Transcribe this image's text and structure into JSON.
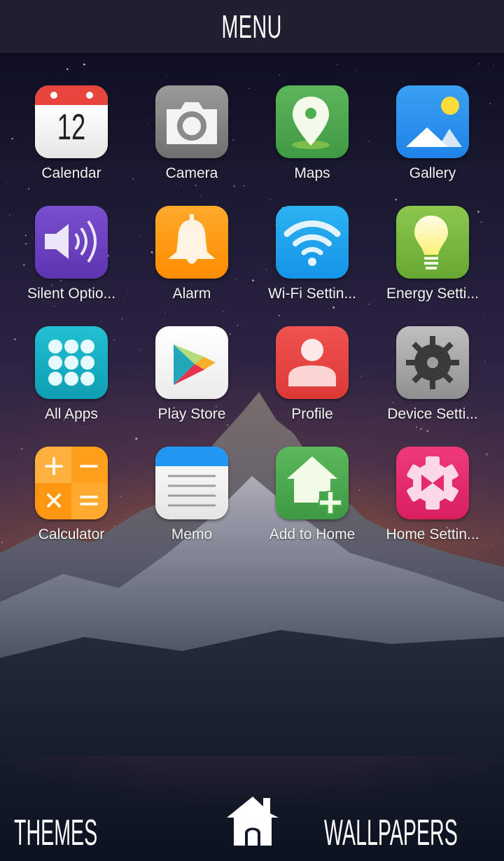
{
  "header": {
    "title": "MENU"
  },
  "apps": [
    {
      "label": "Calendar",
      "icon": "calendar-icon",
      "day": "12",
      "color": "#e8453c"
    },
    {
      "label": "Camera",
      "icon": "camera-icon",
      "color": "#8e8e8e"
    },
    {
      "label": "Maps",
      "icon": "map-pin-icon",
      "color": "#4caf50"
    },
    {
      "label": "Gallery",
      "icon": "gallery-icon",
      "color": "#2196f3"
    },
    {
      "label": "Silent Optio...",
      "icon": "speaker-icon",
      "color": "#6a3fc1"
    },
    {
      "label": "Alarm",
      "icon": "bell-icon",
      "color": "#ff9a12"
    },
    {
      "label": "Wi-Fi Settin...",
      "icon": "wifi-icon",
      "color": "#1ea6ee"
    },
    {
      "label": "Energy Setti...",
      "icon": "lightbulb-icon",
      "color": "#7cbd42"
    },
    {
      "label": "All Apps",
      "icon": "grid-dots-icon",
      "color": "#1bb5c9"
    },
    {
      "label": "Play Store",
      "icon": "play-store-icon",
      "color": "#f2f2f2"
    },
    {
      "label": "Profile",
      "icon": "person-icon",
      "color": "#e8403d"
    },
    {
      "label": "Device Setti...",
      "icon": "gear-icon",
      "color": "#a8a8a8"
    },
    {
      "label": "Calculator",
      "icon": "calculator-icon",
      "color": "#ffa726"
    },
    {
      "label": "Memo",
      "icon": "memo-icon",
      "color": "#2196f3"
    },
    {
      "label": "Add to Home",
      "icon": "add-home-icon",
      "color": "#4caf50"
    },
    {
      "label": "Home Settin...",
      "icon": "home-settings-icon",
      "color": "#e62a6e"
    }
  ],
  "bottom": {
    "themes": "THEMES",
    "wallpapers": "WALLPAPERS",
    "home_icon": "home-icon"
  }
}
